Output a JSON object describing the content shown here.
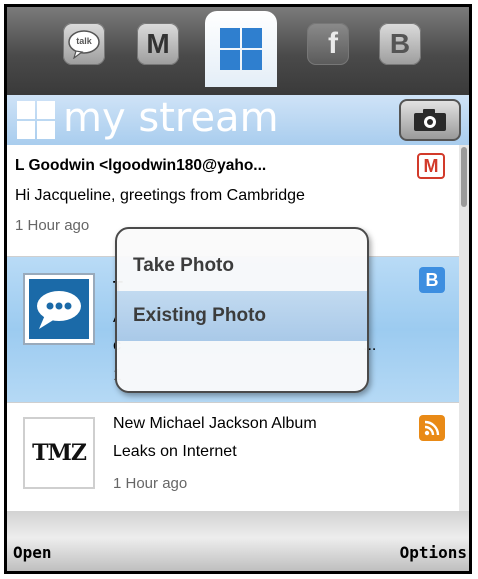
{
  "title_bar": {
    "title": "my stream"
  },
  "tabs": [
    {
      "name": "talk",
      "label": "talk"
    },
    {
      "name": "gmail",
      "label": "M"
    },
    {
      "name": "mystream",
      "label": ""
    },
    {
      "name": "facebook",
      "label": "f"
    },
    {
      "name": "twitter",
      "label": "B"
    }
  ],
  "stream": [
    {
      "sender": "L Goodwin <lgoodwin180@yaho...",
      "subject": "Hi Jacqueline, greetings from Cambridge",
      "time": "1 Hour ago",
      "service": "gmail",
      "service_icon": "M"
    },
    {
      "line1": "T",
      "line2": "A",
      "line3": "c",
      "trail": "...",
      "time": "1",
      "service": "twitter",
      "service_icon": "B",
      "thumb_icon": "speech-bubble-icon"
    },
    {
      "line1": "New Michael Jackson Album",
      "line2": "Leaks on Internet",
      "time": "1 Hour ago",
      "service": "rss",
      "thumb_text": "TMZ"
    }
  ],
  "popup_menu": {
    "items": [
      "Take Photo",
      "Existing Photo"
    ],
    "highlighted": "Existing Photo"
  },
  "softkeys": {
    "left": "Open",
    "right": "Options"
  },
  "colors": {
    "accent": "#a9cdee",
    "gmail_red": "#d23a2a",
    "twitter_blue": "#3d8ee0",
    "rss_orange": "#e98a16"
  }
}
